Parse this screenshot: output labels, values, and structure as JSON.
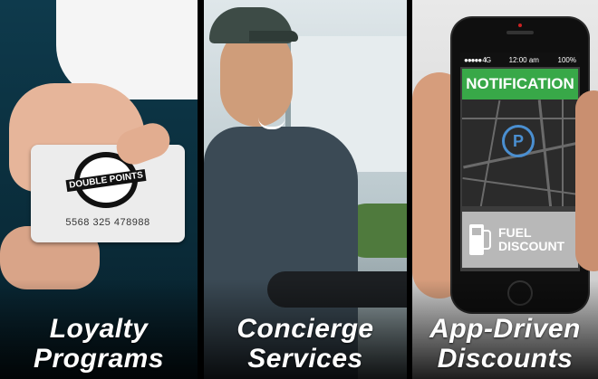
{
  "panels": [
    {
      "caption_line1": "Loyalty",
      "caption_line2": "Programs",
      "card": {
        "seal_text": "DOUBLE POINTS",
        "number": "5568  325  478988"
      }
    },
    {
      "caption_line1": "Concierge",
      "caption_line2": "Services"
    },
    {
      "caption_line1": "App-Driven",
      "caption_line2": "Discounts",
      "phone": {
        "signal": "●●●●● 4G",
        "time": "12:00 am",
        "battery": "100%",
        "notification": "NOTIFICATION",
        "map_pin": "P",
        "fuel_line1": "FUEL",
        "fuel_line2": "DISCOUNT"
      }
    }
  ],
  "colors": {
    "notification_green": "#38a848",
    "pin_blue": "#4a8fd1"
  }
}
